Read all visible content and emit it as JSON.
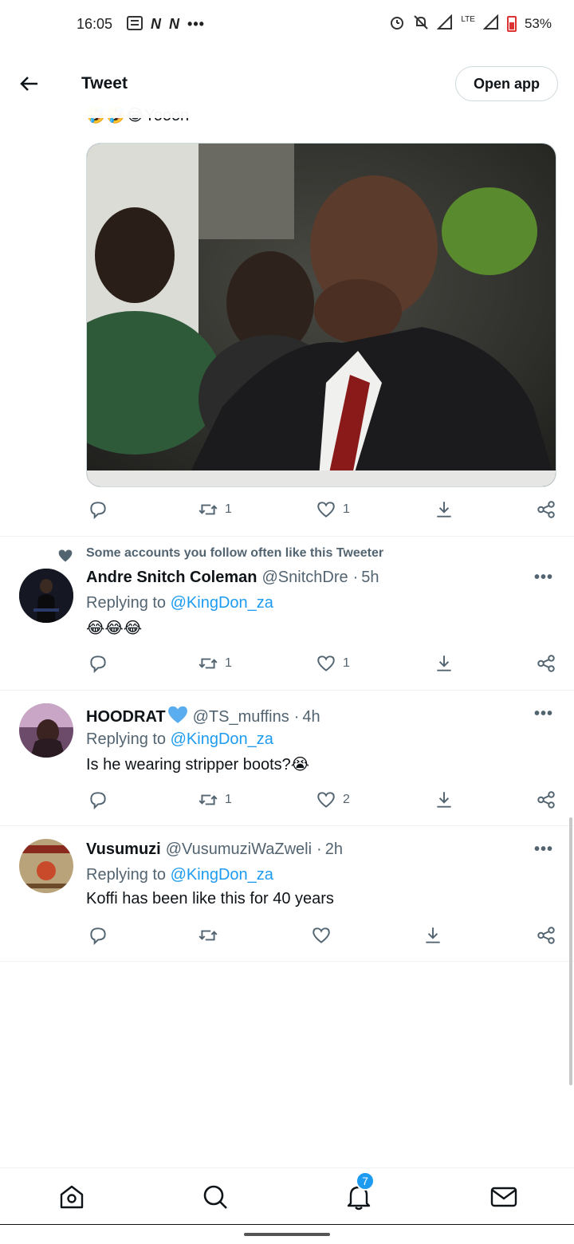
{
  "status_bar": {
    "time": "16:05",
    "left_icons": [
      "notes-icon",
      "netflix-icon",
      "netflix-icon",
      "more-dots-icon"
    ],
    "right_icons": [
      "alarm-icon",
      "mute-icon",
      "signal-icon",
      "lte-signal-icon",
      "battery-icon"
    ],
    "lte_label": "LTE",
    "battery_percent": "53%",
    "battery_color": "#d33333"
  },
  "header": {
    "title": "Tweet",
    "open_app_label": "Open app"
  },
  "main_tweet": {
    "text_suffix": "Yooon",
    "emojis": "🤣🤣😂",
    "actions": {
      "retweets": "1",
      "likes": "1"
    }
  },
  "replies": [
    {
      "social_context": "Some accounts you follow often like this Tweeter",
      "name": "Andre Snitch Coleman",
      "handle": "@SnitchDre",
      "time": "5h",
      "replying_prefix": "Replying to ",
      "replying_to": "@KingDon_za",
      "text": "😂😂😂",
      "retweets": "1",
      "likes": "1"
    },
    {
      "name": "HOODRAT",
      "verified_heart": true,
      "handle": "@TS_muffins",
      "time": "4h",
      "replying_prefix": "Replying to ",
      "replying_to": "@KingDon_za",
      "text": "Is he wearing stripper boots?😭",
      "retweets": "1",
      "likes": "2"
    },
    {
      "name": "Vusumuzi",
      "handle": "@VusumuziWaZweli",
      "time": "2h",
      "replying_prefix": "Replying to ",
      "replying_to": "@KingDon_za",
      "text": "Koffi has been like this for 40 years",
      "retweets": "",
      "likes": ""
    }
  ],
  "bottom_nav": {
    "items": [
      "home-icon",
      "search-icon",
      "notifications-icon",
      "messages-icon"
    ],
    "notification_count": "7"
  },
  "colors": {
    "accent": "#1d9bf0",
    "text": "#0f1419",
    "secondary": "#536471"
  }
}
